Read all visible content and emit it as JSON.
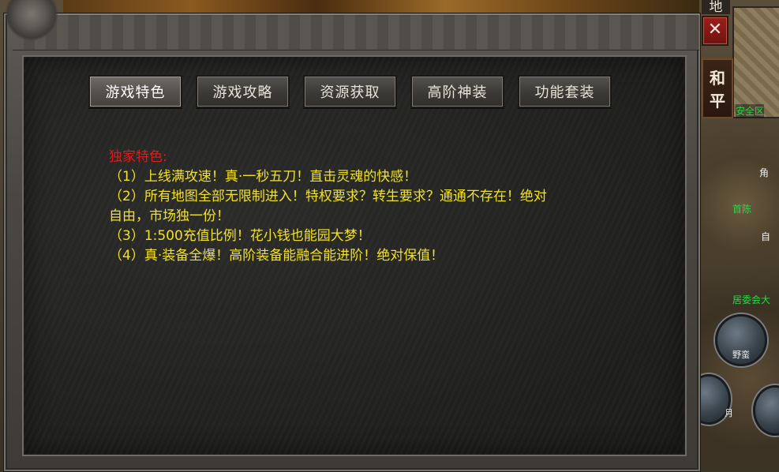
{
  "tabs": [
    {
      "label": "游戏特色",
      "active": true
    },
    {
      "label": "游戏攻略",
      "active": false
    },
    {
      "label": "资源获取",
      "active": false
    },
    {
      "label": "高阶神装",
      "active": false
    },
    {
      "label": "功能套装",
      "active": false
    }
  ],
  "content": {
    "heading": "独家特色:",
    "lines": [
      "（1）上线满攻速！真·一秒五刀！直击灵魂的快感！",
      "（2）所有地图全部无限制进入！特权要求？转生要求？通通不存在！绝对",
      "自由，市场独一份！",
      "（3）1:500充值比例！花小钱也能园大梦！",
      "（4）真·装备全爆！高阶装备能融合能进阶！绝对保值！"
    ]
  },
  "side": {
    "map_char": "地",
    "close_glyph": "✕",
    "peace_mode": [
      "和",
      "平"
    ],
    "safe_zone": "安全区",
    "npc_labels": [
      "角",
      "首陈",
      "自",
      "居委会大"
    ],
    "skill_label": "野蛮",
    "skill_label_2": "月"
  },
  "colors": {
    "heading": "#e21b1b",
    "text": "#f1e12a",
    "tab_text": "#e8e4d8"
  }
}
